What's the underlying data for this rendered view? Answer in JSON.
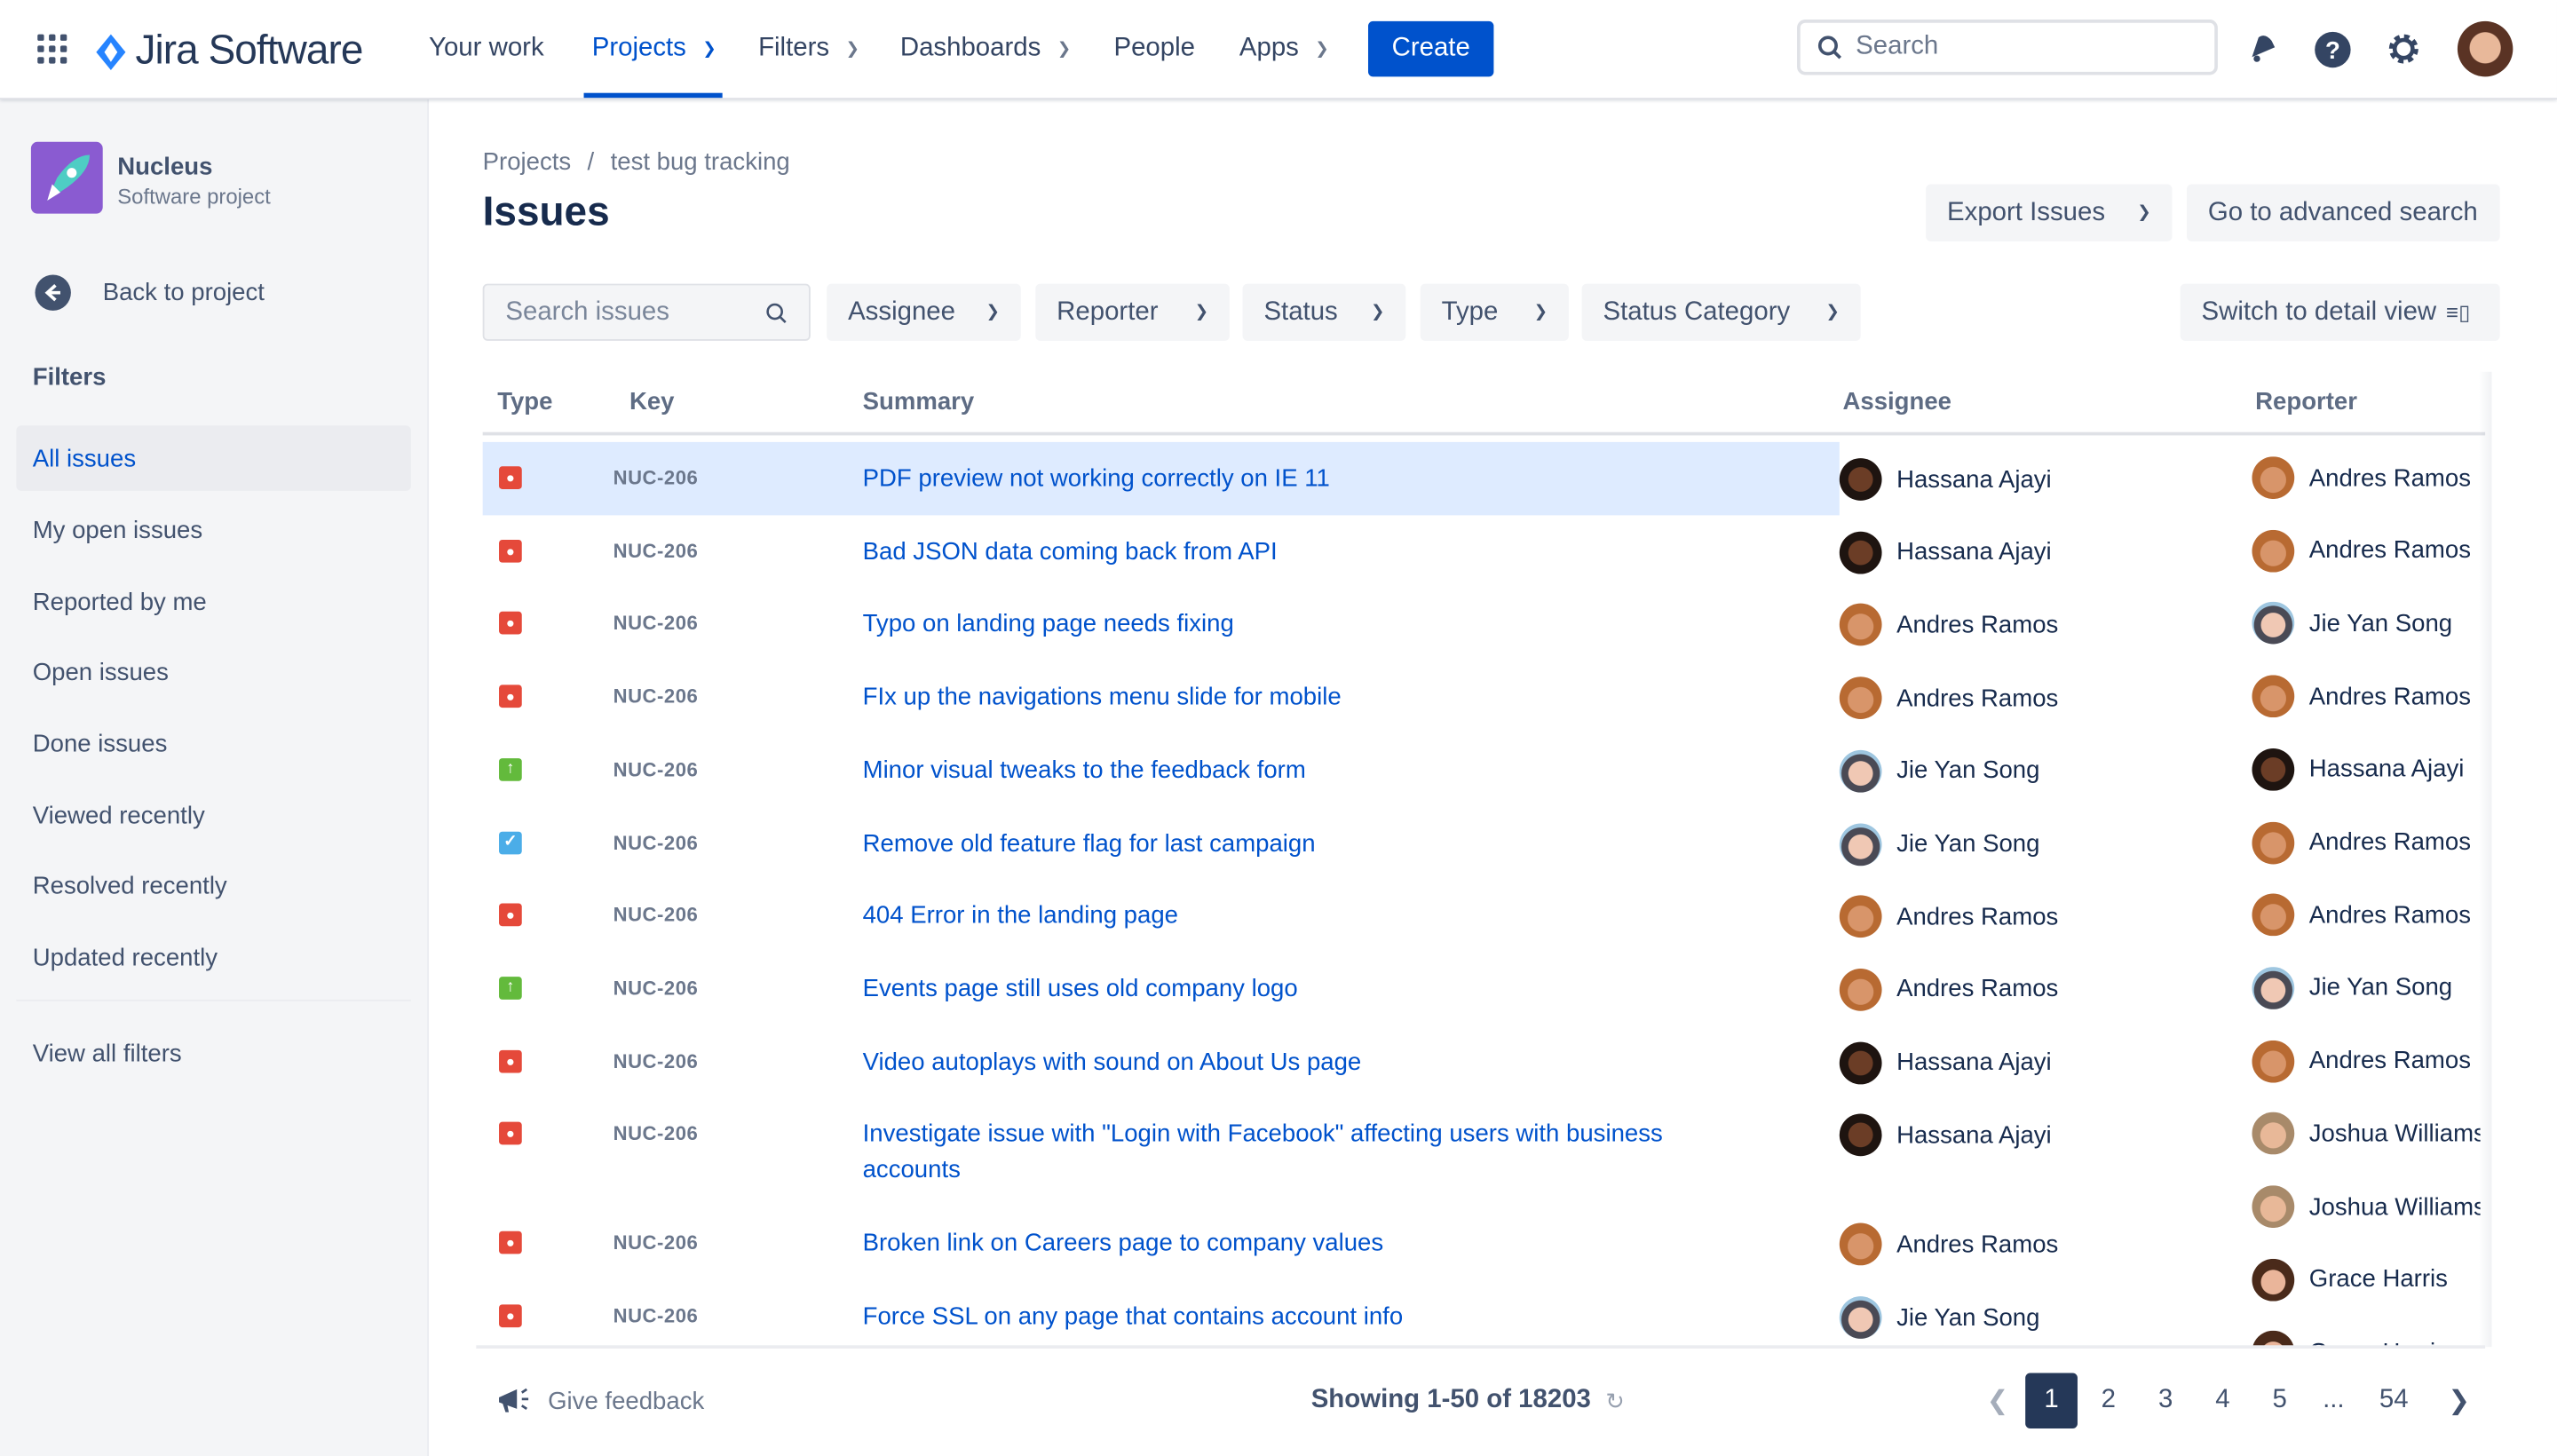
{
  "topnav": {
    "app_name": "Jira Software",
    "items": [
      {
        "label": "Your work",
        "dropdown": false
      },
      {
        "label": "Projects",
        "dropdown": true,
        "active": true
      },
      {
        "label": "Filters",
        "dropdown": true
      },
      {
        "label": "Dashboards",
        "dropdown": true
      },
      {
        "label": "People",
        "dropdown": false
      },
      {
        "label": "Apps",
        "dropdown": true
      }
    ],
    "create_label": "Create",
    "search_placeholder": "Search",
    "accent": "#0052cc"
  },
  "sidebar": {
    "project_name": "Nucleus",
    "project_type": "Software project",
    "back_label": "Back to project",
    "filters_heading": "Filters",
    "items": [
      {
        "label": "All issues",
        "selected": true
      },
      {
        "label": "My open issues"
      },
      {
        "label": "Reported by me"
      },
      {
        "label": "Open issues"
      },
      {
        "label": "Done issues"
      },
      {
        "label": "Viewed recently"
      },
      {
        "label": "Resolved recently"
      },
      {
        "label": "Updated recently"
      }
    ],
    "view_all_label": "View all filters"
  },
  "page": {
    "breadcrumb": [
      "Projects",
      "test bug tracking"
    ],
    "breadcrumb_sep": "/",
    "title": "Issues",
    "export_label": "Export Issues",
    "advanced_search_label": "Go to advanced search",
    "search_placeholder": "Search issues",
    "filters": [
      "Assignee",
      "Reporter",
      "Status",
      "Type",
      "Status Category"
    ],
    "detail_view_label": "Switch to detail view"
  },
  "table": {
    "columns": [
      "Type",
      "Key",
      "Summary",
      "Assignee",
      "Reporter"
    ],
    "rows": [
      {
        "type": "bug",
        "key": "NUC-206",
        "summary": "PDF preview not working correctly on IE 11",
        "assignee": "Hassana Ajayi"
      },
      {
        "type": "bug",
        "key": "NUC-206",
        "summary": "Bad JSON data coming back from API",
        "assignee": "Hassana Ajayi"
      },
      {
        "type": "bug",
        "key": "NUC-206",
        "summary": "Typo on landing page needs fixing",
        "assignee": "Andres Ramos"
      },
      {
        "type": "bug",
        "key": "NUC-206",
        "summary": "FIx up the navigations menu slide for mobile",
        "assignee": "Andres Ramos"
      },
      {
        "type": "improvement",
        "key": "NUC-206",
        "summary": "Minor visual tweaks to the feedback form",
        "assignee": "Jie Yan Song"
      },
      {
        "type": "task",
        "key": "NUC-206",
        "summary": "Remove old feature flag for last campaign",
        "assignee": "Jie Yan Song"
      },
      {
        "type": "bug",
        "key": "NUC-206",
        "summary": "404 Error in the landing page",
        "assignee": "Andres Ramos"
      },
      {
        "type": "improvement",
        "key": "NUC-206",
        "summary": "Events page still uses old company logo",
        "assignee": "Andres Ramos"
      },
      {
        "type": "bug",
        "key": "NUC-206",
        "summary": "Video autoplays with sound on About Us page",
        "assignee": "Hassana Ajayi"
      },
      {
        "type": "bug",
        "key": "NUC-206",
        "summary": "Investigate issue with \"Login with Facebook\" affecting users with business accounts",
        "assignee": "Hassana Ajayi"
      },
      {
        "type": "bug",
        "key": "NUC-206",
        "summary": "Broken link on Careers page to company values",
        "assignee": "Andres Ramos"
      },
      {
        "type": "bug",
        "key": "NUC-206",
        "summary": "Force SSL on any page that contains account info",
        "assignee": "Jie Yan Song"
      }
    ],
    "reporters": [
      "Andres Ramos",
      "Andres Ramos",
      "Jie Yan Song",
      "Andres Ramos",
      "Hassana Ajayi",
      "Andres Ramos",
      "Andres Ramos",
      "Jie Yan Song",
      "Andres Ramos",
      "Joshua Williams",
      "Joshua Williams",
      "Grace Harris",
      "Grace Harris"
    ]
  },
  "footer": {
    "feedback_label": "Give feedback",
    "showing": "Showing 1-50 of 18203",
    "pages": [
      "1",
      "2",
      "3",
      "4",
      "5",
      "...",
      "54"
    ],
    "current_page": "1"
  },
  "colors": {
    "bug": "#e5493a",
    "improvement": "#63ba3c",
    "task": "#4bade8"
  }
}
